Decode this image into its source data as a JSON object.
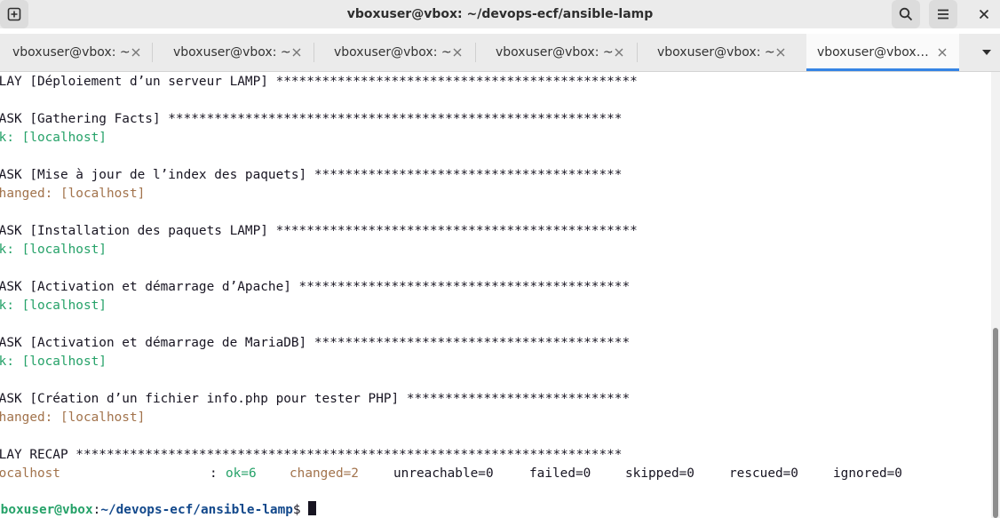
{
  "window": {
    "title": "vboxuser@vbox: ~/devops-ecf/ansible-lamp"
  },
  "tabs": [
    {
      "label": "vboxuser@vbox: ~"
    },
    {
      "label": "vboxuser@vbox: ~"
    },
    {
      "label": "vboxuser@vbox: ~"
    },
    {
      "label": "vboxuser@vbox: ~"
    },
    {
      "label": "vboxuser@vbox: ~"
    },
    {
      "label": "vboxuser@vbox…"
    }
  ],
  "terminal": {
    "lines": [
      {
        "text": "PLAY [Déploiement d’un serveur LAMP] ***********************************************"
      },
      {
        "text": "TASK [Gathering Facts] ***********************************************************"
      },
      {
        "ok_text": "ok: [localhost]"
      },
      {
        "text": "TASK [Mise à jour de l’index des paquets] ****************************************"
      },
      {
        "chg_text": "changed: [localhost]"
      },
      {
        "text": "TASK [Installation des paquets LAMP] ***********************************************"
      },
      {
        "ok_text": "ok: [localhost]"
      },
      {
        "text": "TASK [Activation et démarrage d’Apache] *******************************************"
      },
      {
        "ok_text": "ok: [localhost]"
      },
      {
        "text": "TASK [Activation et démarrage de MariaDB] *****************************************"
      },
      {
        "ok_text": "ok: [localhost]"
      },
      {
        "text": "TASK [Création d’un fichier info.php pour tester PHP] *****************************"
      },
      {
        "chg_text": "changed: [localhost]"
      },
      {
        "text": "PLAY RECAP ***********************************************************************"
      }
    ],
    "recap": {
      "host": "localhost",
      "colon": ":",
      "ok": "ok=6",
      "changed": "changed=2",
      "unreachable": "unreachable=0",
      "failed": "failed=0",
      "skipped": "skipped=0",
      "rescued": "rescued=0",
      "ignored": "ignored=0"
    },
    "prompt": {
      "user_host": "vboxuser@vbox",
      "separator": ":",
      "path": "~/devops-ecf/ansible-lamp",
      "symbol": "$"
    }
  },
  "colors": {
    "ok": "#26a269",
    "changed": "#a2734c",
    "path": "#12488b",
    "tab_accent": "#3584e4"
  }
}
